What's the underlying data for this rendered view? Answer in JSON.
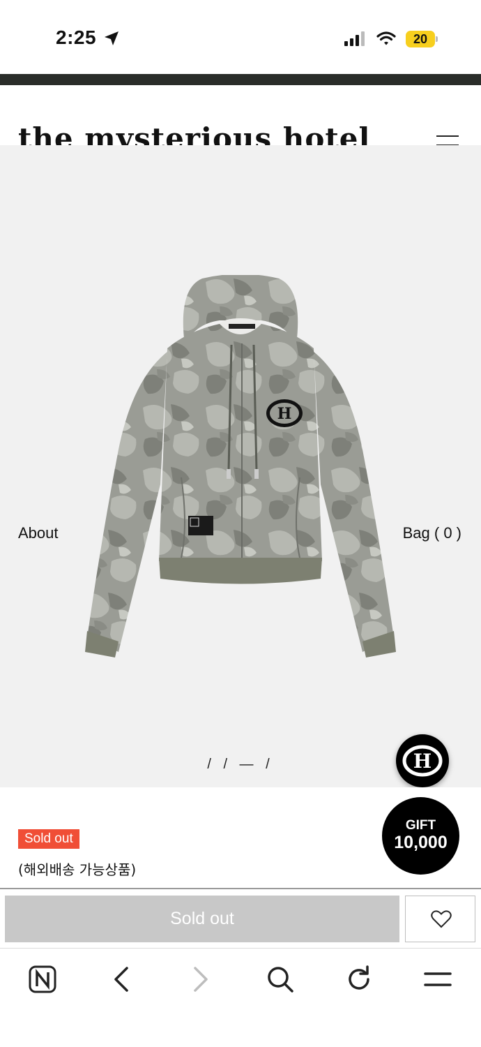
{
  "status_bar": {
    "time": "2:25",
    "battery_level": "20",
    "icons": [
      "location-arrow-icon",
      "cellular-signal-icon",
      "wifi-icon",
      "battery-icon"
    ]
  },
  "header": {
    "logo_text": "the mysterious hotel",
    "menu_icon": "hamburger-menu-icon"
  },
  "nav": {
    "about_label": "About",
    "bag_label": "Bag ( 0 )"
  },
  "product": {
    "image_alt": "camo zip-up hoodie",
    "slide_indicator": "/ / — /",
    "status_badge": "Sold out",
    "shipping_note": "(해외배송 가능상품)"
  },
  "floating": {
    "logo_button_icon": "h-logo-icon",
    "gift_label": "GIFT",
    "gift_amount": "10,000"
  },
  "actions": {
    "buy_button_label": "Sold out",
    "wishlist_icon": "heart-icon"
  },
  "browser_toolbar": {
    "items": [
      "naver-n-icon",
      "back-arrow-icon",
      "forward-arrow-icon",
      "search-icon",
      "refresh-icon",
      "menu-icon"
    ]
  },
  "colors": {
    "badge_red": "#f04e36",
    "disabled_gray": "#c8c8c8",
    "top_strip": "#2a2d29",
    "battery_yellow": "#f7cf1e",
    "product_bg": "#f1f1f1"
  }
}
